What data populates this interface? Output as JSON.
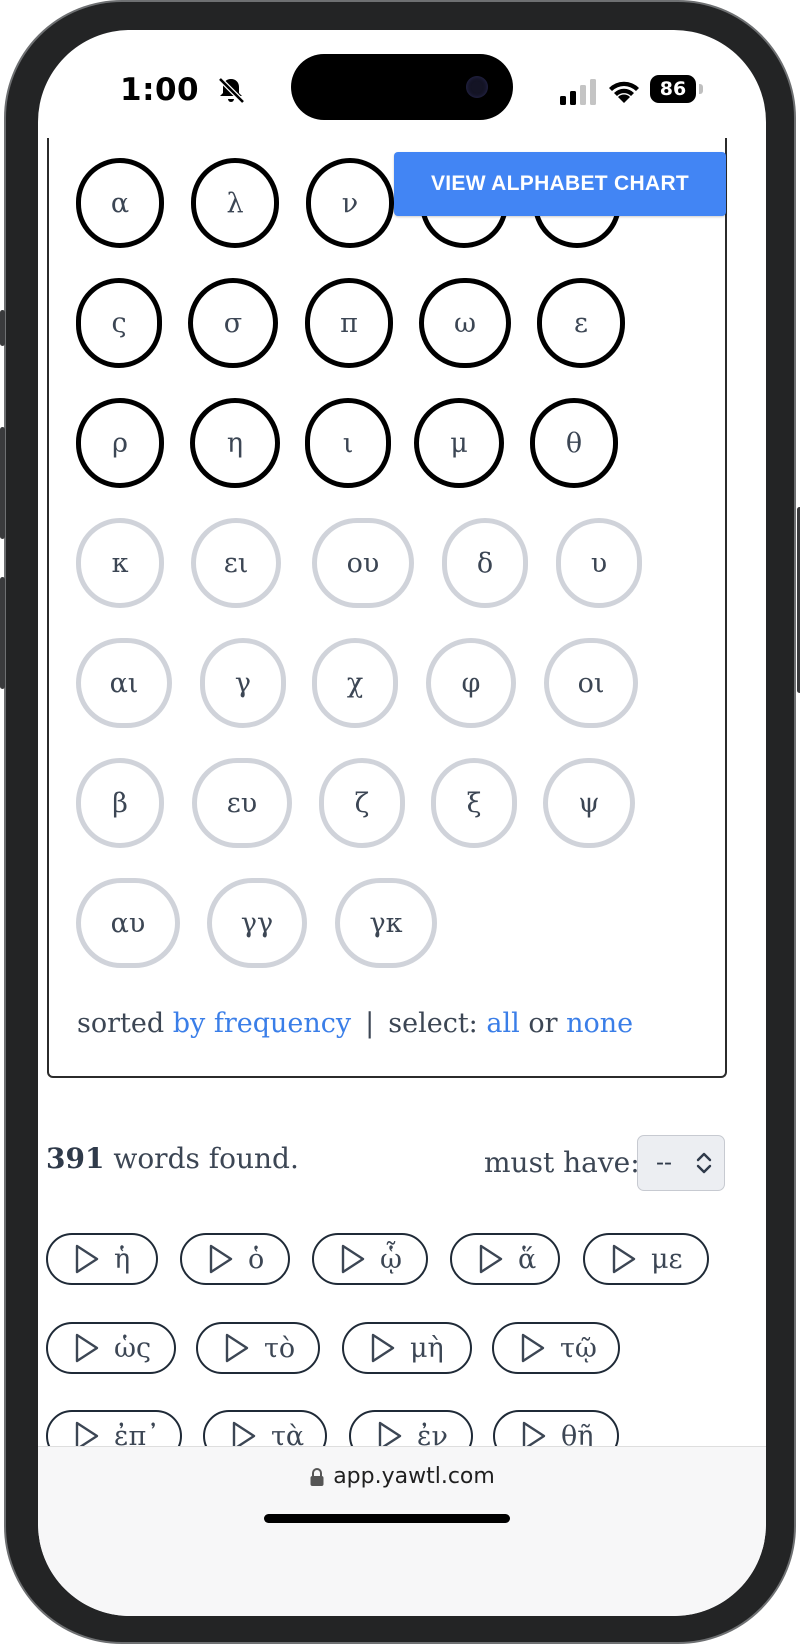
{
  "status_bar": {
    "time": "1:00",
    "battery": "86"
  },
  "panel": {
    "chart_button_label": "VIEW ALPHABET CHART",
    "selected_letters": [
      "α",
      "λ",
      "ν",
      "",
      "",
      "ς",
      "σ",
      "π",
      "ω",
      "ε",
      "ρ",
      "η",
      "ι",
      "μ",
      "θ"
    ],
    "unselected_letters": [
      "κ",
      "ει",
      "ου",
      "δ",
      "υ",
      "αι",
      "γ",
      "χ",
      "φ",
      "οι",
      "β",
      "ευ",
      "ζ",
      "ξ",
      "ψ",
      "αυ",
      "γγ",
      "γκ"
    ],
    "sort_prefix": "sorted",
    "sort_link": "by frequency",
    "separator": "|",
    "select_prefix": "select:",
    "select_all": "all",
    "select_or": "or",
    "select_none": "none"
  },
  "results": {
    "count": "391",
    "count_suffix": "words found.",
    "must_have_label": "must have:",
    "must_have_value": "--",
    "words": [
      "ἡ",
      "ὁ",
      "ᾧ",
      "ἅ",
      "με",
      "ὡς",
      "τὸ",
      "μὴ",
      "τῷ",
      "ἐπ᾽",
      "τὰ",
      "ἐν",
      "θῆ"
    ]
  },
  "browser": {
    "url": "app.yawtl.com"
  },
  "colors": {
    "accent": "#4285f4",
    "link": "#3a7ee8",
    "selected_border": "#000000",
    "unselected_border": "#d0d3da"
  }
}
